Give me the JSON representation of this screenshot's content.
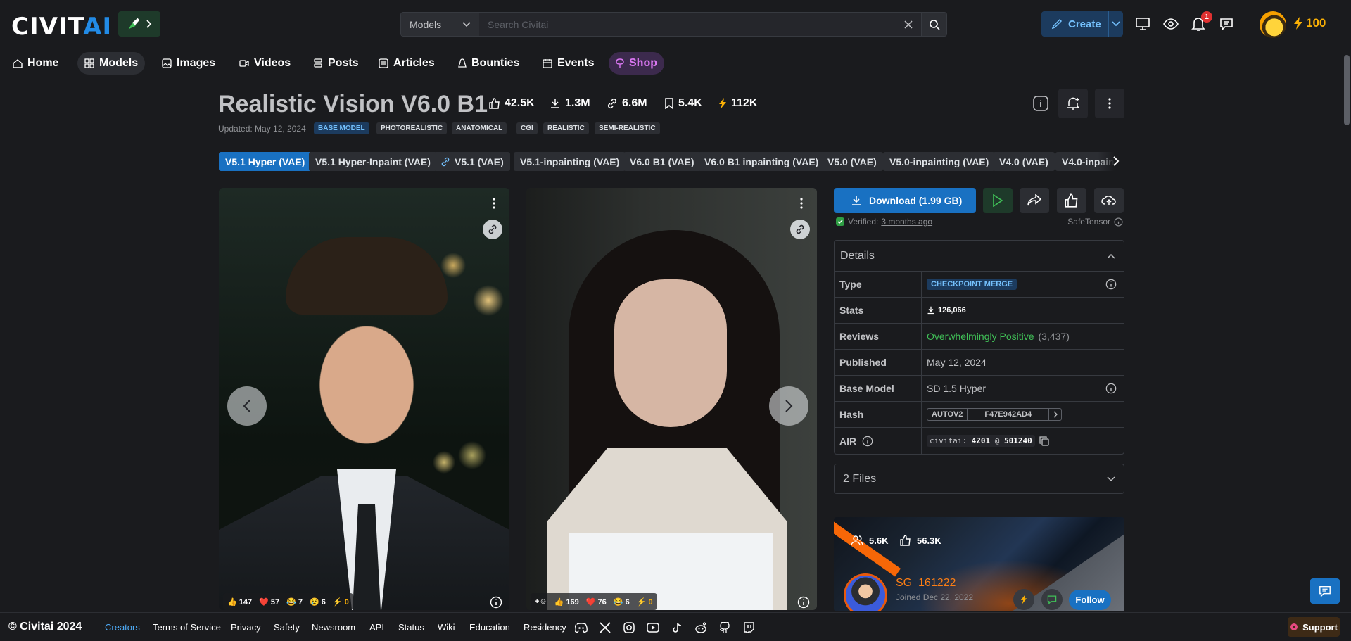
{
  "header": {
    "logo_text_a": "CIVIT",
    "logo_text_b": "AI",
    "search": {
      "scope": "Models",
      "placeholder": "Search Civitai"
    },
    "create_label": "Create",
    "notification_count": "1",
    "buzz_amount": "100"
  },
  "nav": {
    "items": [
      {
        "label": "Home",
        "icon": "home-icon"
      },
      {
        "label": "Models",
        "icon": "grid-icon"
      },
      {
        "label": "Images",
        "icon": "image-icon"
      },
      {
        "label": "Videos",
        "icon": "video-icon"
      },
      {
        "label": "Posts",
        "icon": "posts-icon"
      },
      {
        "label": "Articles",
        "icon": "article-icon"
      },
      {
        "label": "Bounties",
        "icon": "bounty-icon"
      },
      {
        "label": "Events",
        "icon": "calendar-icon"
      },
      {
        "label": "Shop",
        "icon": "shop-icon"
      }
    ],
    "active": "Models"
  },
  "model": {
    "title": "Realistic Vision V6.0 B1",
    "stats": {
      "likes": "42.5K",
      "downloads": "1.3M",
      "generations": "6.6M",
      "bookmarks": "5.4K",
      "buzz": "112K"
    },
    "updated": "Updated: May 12, 2024",
    "tags": [
      "BASE MODEL",
      "PHOTOREALISTIC",
      "ANATOMICAL",
      "CGI",
      "REALISTIC",
      "SEMI-REALISTIC"
    ],
    "versions": [
      "V5.1 Hyper (VAE)",
      "V5.1 Hyper-Inpaint (VAE)",
      "V5.1 (VAE)",
      "V5.1-inpainting (VAE)",
      "V6.0 B1 (VAE)",
      "V6.0 B1 inpainting (VAE)",
      "V5.0 (VAE)",
      "V5.0-inpainting (VAE)",
      "V4.0 (VAE)",
      "V4.0-inpain"
    ]
  },
  "images": [
    {
      "reactions": [
        "147",
        "57",
        "7",
        "6",
        "0"
      ]
    },
    {
      "reactions": [
        "169",
        "76",
        "6",
        "0"
      ]
    }
  ],
  "download": {
    "label": "Download (1.99 GB)",
    "verified_label": "Verified:",
    "verified_ago": "3 months ago",
    "format": "SafeTensor"
  },
  "details": {
    "header": "Details",
    "rows": {
      "type_label": "Type",
      "type_value": "CHECKPOINT MERGE",
      "stats_label": "Stats",
      "stats_value": "126,066",
      "reviews_label": "Reviews",
      "reviews_value": "Overwhelmingly Positive",
      "reviews_count": "(3,437)",
      "published_label": "Published",
      "published_value": "May 12, 2024",
      "base_label": "Base Model",
      "base_value": "SD 1.5 Hyper",
      "hash_label": "Hash",
      "hash_type": "AUTOV2",
      "hash_value": "F47E942AD4",
      "air_label": "AIR",
      "air_prefix": "civitai:",
      "air_model": "4201",
      "air_at": "@",
      "air_version": "501240"
    }
  },
  "files_label": "2 Files",
  "creator": {
    "followers": "5.6K",
    "likes": "56.3K",
    "name": "SG_161222",
    "joined": "Joined Dec 22, 2022",
    "follow_label": "Follow"
  },
  "footer": {
    "copyright": "© Civitai 2024",
    "links": [
      "Creators",
      "Terms of Service",
      "Privacy",
      "Safety",
      "Newsroom",
      "API",
      "Status",
      "Wiki",
      "Education",
      "Residency"
    ],
    "support_label": "Support"
  },
  "colors": {
    "accent": "#1971c2",
    "background": "#1a1b1e",
    "buzz": "#fab005",
    "positive": "#40c057",
    "creator_name": "#fd7e14"
  }
}
